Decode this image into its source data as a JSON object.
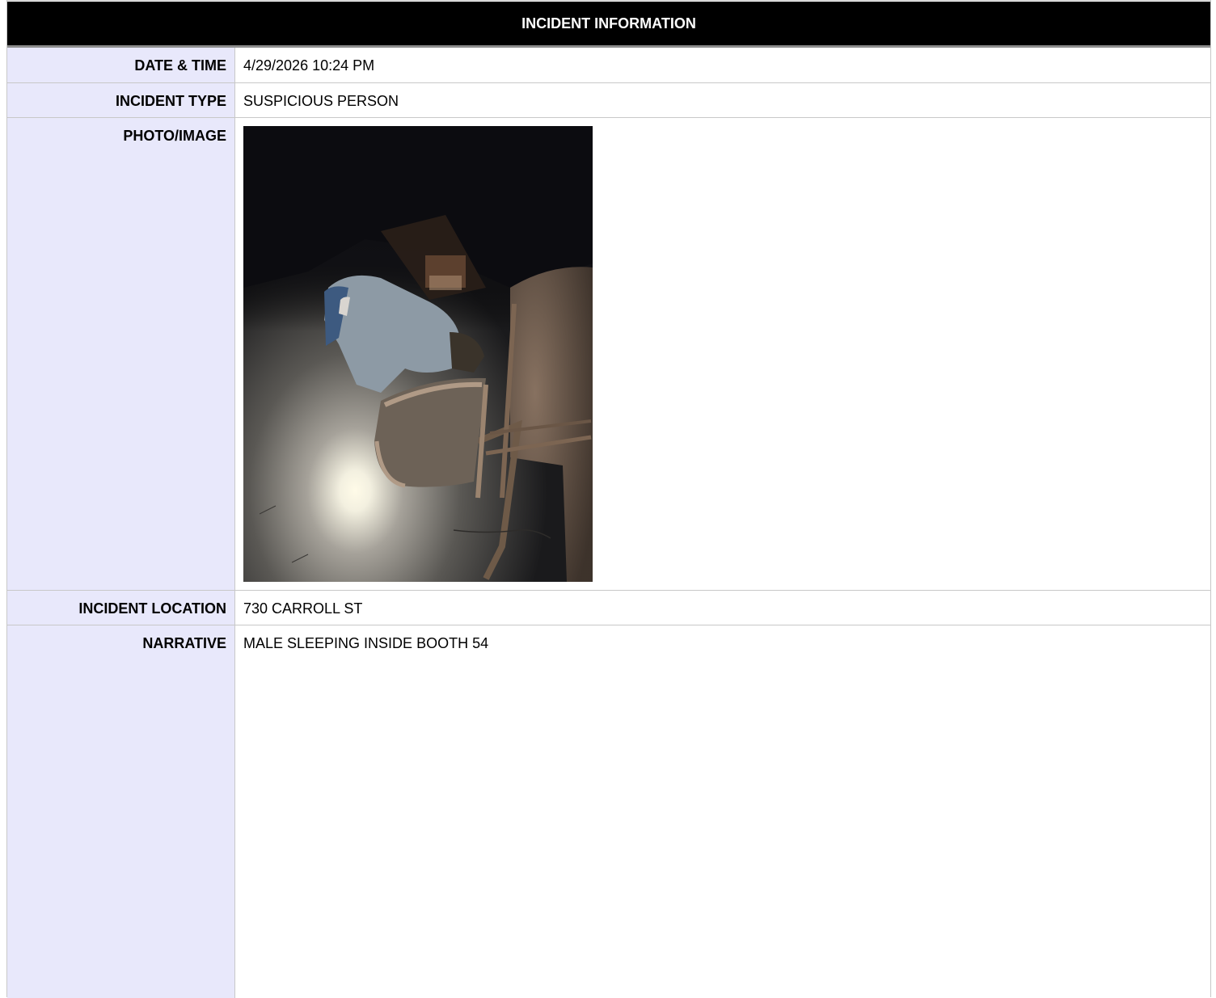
{
  "header": {
    "title": "INCIDENT INFORMATION"
  },
  "fields": {
    "date_time": {
      "label": "DATE & TIME",
      "value": "4/29/2026 10:24 PM"
    },
    "incident_type": {
      "label": "INCIDENT TYPE",
      "value": "SUSPICIOUS PERSON"
    },
    "photo": {
      "label": "PHOTO/IMAGE"
    },
    "location": {
      "label": "INCIDENT LOCATION",
      "value": "730 CARROLL ST"
    },
    "narrative": {
      "label": "NARRATIVE",
      "value": "MALE SLEEPING INSIDE BOOTH 54"
    }
  },
  "colors": {
    "header_bg": "#000000",
    "label_bg": "#e8e8fb",
    "border": "#c8c8c8"
  }
}
